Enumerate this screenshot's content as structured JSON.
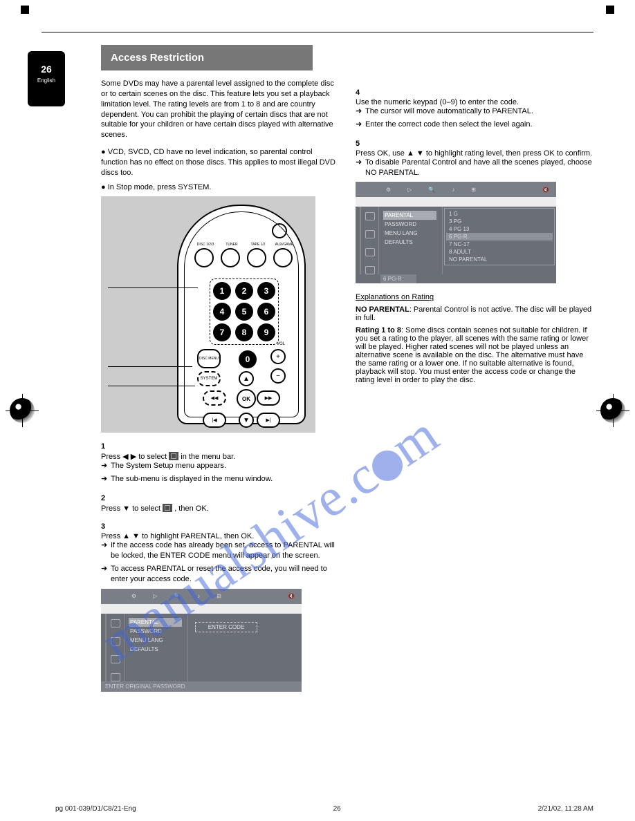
{
  "page_label": {
    "num": "26",
    "lang": "English"
  },
  "header_band": "Access Restriction",
  "intro": [
    "Some DVDs may have a parental level assigned to the complete disc or to certain scenes on the disc. This feature lets you set a playback limitation level. The rating levels are from 1 to 8 and are country dependent. You can prohibit the playing of certain discs that are not suitable for your children or have certain discs played with alternative scenes."
  ],
  "bullets": [
    "VCD, SVCD, CD have no level indication, so parental control function has no effect on those discs. This applies to most illegal DVD discs too.",
    "In Stop mode, press SYSTEM."
  ],
  "remote": {
    "sources": [
      "DISC 1/2/3",
      "TUNER",
      "TAPE 1/2",
      "AUX/GAME"
    ],
    "keypad": [
      "1",
      "2",
      "3",
      "4",
      "5",
      "6",
      "7",
      "8",
      "9",
      "0"
    ],
    "disc_menu": "DISC MENU",
    "system": "SYSTEM",
    "vol_label": "VOL",
    "ok": "OK"
  },
  "steps_left": {
    "s1_title": "1",
    "s1_text": "Press ◀ ▶ to select        in the menu bar.",
    "arrow1": "The System Setup menu appears.",
    "sub": "The sub-menu is displayed in the menu window.",
    "s2_title": "2",
    "s2_text": "Press ▼ to select        , then OK.",
    "s3_title": "3",
    "s3_text": "Press ▲ ▼ to highlight PARENTAL, then OK.",
    "arrow2": "If the access code has already been set, access to PARENTAL will be locked, the ENTER CODE menu will appear on the screen.",
    "arrow3": "To access PARENTAL or reset the access code, you will need to enter your access code."
  },
  "steps_right": {
    "s4_title": "4",
    "s4_text": "Use the numeric keypad (0–9) to enter the code.",
    "arrow1": "The cursor will move automatically to PARENTAL.",
    "arrow2": "Enter the correct code then select the level again.",
    "s5_title": "5",
    "s5_text": "Press OK, use ▲ ▼ to highlight rating level, then press OK to confirm.",
    "arrow3": "To disable Parental Control and have all the scenes played, choose NO PARENTAL."
  },
  "osd_menu": [
    "PARENTAL",
    "PASSWORD",
    "MENU LANG",
    "DEFAULTS"
  ],
  "osd_hint_left": "ENTER ORIGINAL PASSWORD",
  "osd_entercode": "ENTER CODE",
  "osd_ratings": [
    "1 G",
    "3 PG",
    "4 PG 13",
    "6 PG-R",
    "7 NC-17",
    "8 ADULT",
    "NO PARENTAL"
  ],
  "osd_rating_sel": "6 PG-R",
  "explain": {
    "head": "Explanations on Rating",
    "no_parental_label": "NO PARENTAL",
    "no_parental_text": ": Parental Control is not active. The disc will be played in full.",
    "rating18_label": "Rating 1 to 8",
    "rating18_text": ": Some discs contain scenes not suitable for children. If you set a rating to the player, all scenes with the same rating or lower will be played. Higher rated scenes will not be played unless an alternative scene is available on the disc. The alternative must have the same rating or a lower one. If no suitable alternative is found, playback will stop. You must enter the access code or change the rating level in order to play the disc."
  },
  "footer": {
    "left": "pg 001-039/D1/C8/21-Eng",
    "center": "26",
    "right": "2/21/02, 11:28 AM"
  }
}
